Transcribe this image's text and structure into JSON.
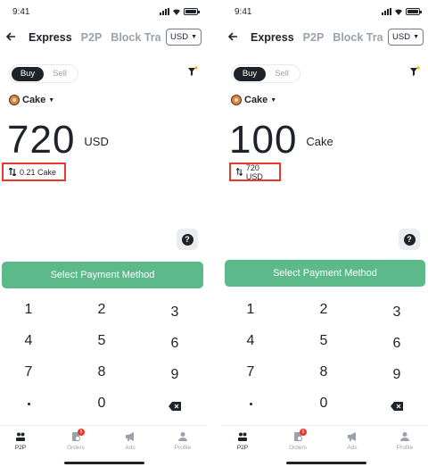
{
  "colors": {
    "brand_green": "#5cb98a",
    "highlight_red": "#e8392a",
    "text_dark": "#1e2329",
    "text_muted": "#9ba2ab"
  },
  "screens": [
    {
      "status_time": "9:41",
      "tabs": [
        "Express",
        "P2P",
        "Block Tra"
      ],
      "currency": "USD",
      "buy_label": "Buy",
      "sell_label": "Sell",
      "coin": "Cake",
      "amount": "720",
      "amount_unit": "USD",
      "conversion": "0.21 Cake",
      "pay_button": "Select Payment Method",
      "keys": [
        "1",
        "2",
        "3",
        "4",
        "5",
        "6",
        "7",
        "8",
        "9",
        "0"
      ],
      "tabbar": {
        "p2p": "P2P",
        "orders": "Orders",
        "ads": "Ads",
        "profile": "Profile",
        "orders_badge": "5"
      }
    },
    {
      "status_time": "9:41",
      "tabs": [
        "Express",
        "P2P",
        "Block Tra"
      ],
      "currency": "USD",
      "buy_label": "Buy",
      "sell_label": "Sell",
      "coin": "Cake",
      "amount": "100",
      "amount_unit": "Cake",
      "conversion": "720 USD",
      "pay_button": "Select Payment Method",
      "keys": [
        "1",
        "2",
        "3",
        "4",
        "5",
        "6",
        "7",
        "8",
        "9",
        "0"
      ],
      "tabbar": {
        "p2p": "P2P",
        "orders": "Orders",
        "ads": "Ads",
        "profile": "Profile",
        "orders_badge": "5"
      }
    }
  ]
}
